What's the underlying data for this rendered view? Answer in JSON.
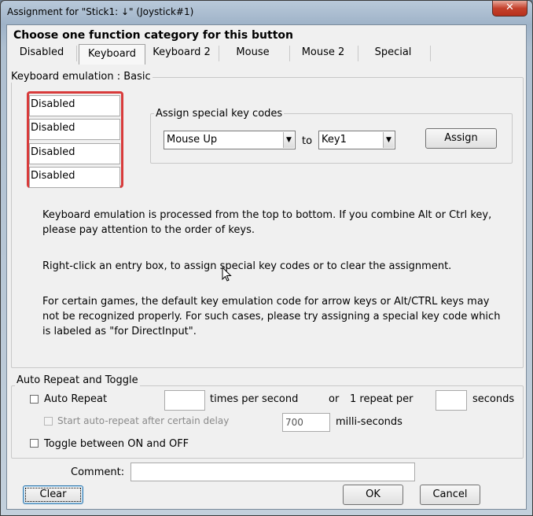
{
  "window": {
    "title": "Assignment for \"Stick1: ↓\" (Joystick#1)",
    "close_glyph": "✕"
  },
  "heading": "Choose one function category for this button",
  "tabs": [
    {
      "label": "Disabled"
    },
    {
      "label": "Keyboard"
    },
    {
      "label": "Keyboard 2"
    },
    {
      "label": "Mouse"
    },
    {
      "label": "Mouse 2"
    },
    {
      "label": "Special"
    }
  ],
  "keyboard_group": {
    "title": "Keyboard emulation : Basic",
    "entries": [
      "Disabled",
      "Disabled",
      "Disabled",
      "Disabled"
    ],
    "special_codes": {
      "title": "Assign special key codes",
      "from_value": "Mouse Up",
      "to_label": "to",
      "to_value": "Key1",
      "assign_label": "Assign"
    },
    "help": {
      "p1_line1": "Keyboard emulation is processed from the top to bottom.  If you combine Alt or Ctrl key,",
      "p1_line2": "please pay attention to the order of keys.",
      "p2": "Right-click an entry box, to assign special key codes or to clear the assignment.",
      "p3_line1": "For certain games, the default key emulation code for arrow keys or Alt/CTRL keys may",
      "p3_line2": "not be recognized properly.  For such cases, please try assigning a special key code which",
      "p3_line3": "is labeled as \"for DirectInput\"."
    }
  },
  "repeat_group": {
    "title": "Auto Repeat and Toggle",
    "auto_repeat_label": "Auto Repeat",
    "times_value": "",
    "times_label": "times per second",
    "or_label": "or",
    "repeat_per_label": "1 repeat per",
    "seconds_value": "",
    "seconds_label": "seconds",
    "delay_label": "Start auto-repeat after certain delay",
    "delay_value": "700",
    "ms_label": "milli-seconds",
    "toggle_label": "Toggle between ON and OFF"
  },
  "comment": {
    "label": "Comment:",
    "value": ""
  },
  "buttons": {
    "clear": "Clear",
    "ok": "OK",
    "cancel": "Cancel"
  },
  "colors": {
    "highlight": "#d83b3b",
    "close": "#c4412c"
  }
}
